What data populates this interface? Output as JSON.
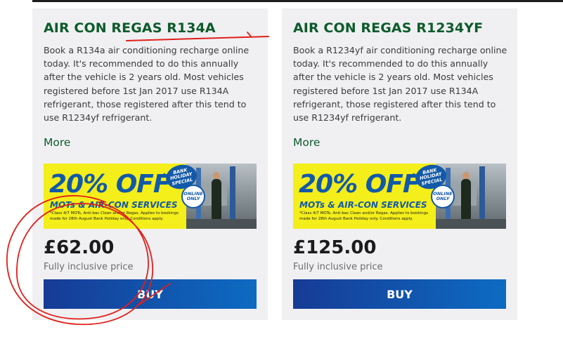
{
  "cards": [
    {
      "title": "AIR CON REGAS R134A",
      "description": "Book a R134a air conditioning recharge online today. It's recommended to do this annually after the vehicle is 2 years old. Most vehicles registered before 1st Jan 2017 use R134A refrigerant, those registered after this tend to use R1234yf refrigerant.",
      "more_label": "More",
      "promo": {
        "headline": "20% OFF",
        "asterisk": "*",
        "subline": "MOTs & AIR-CON SERVICES",
        "fine_print": "*Class 4/7 MOTs, Anti-bac Clean and/or Regas. Applies to bookings made for 28th August Bank Holiday only. Conditions apply.",
        "badge_bank": "BANK\nHOLIDAY\nSPECIAL",
        "badge_online": "ONLINE\nONLY"
      },
      "price": "£62.00",
      "price_note": "Fully inclusive price",
      "buy_label": "BUY"
    },
    {
      "title": "AIR CON REGAS R1234YF",
      "description": "Book a R1234yf air conditioning recharge online today. It's recommended to do this annually after the vehicle is 2 years old. Most vehicles registered before 1st Jan 2017 use R134A refrigerant, those registered after this tend to use R1234yf refrigerant.",
      "more_label": "More",
      "promo": {
        "headline": "20% OFF",
        "asterisk": "*",
        "subline": "MOTs & AIR-CON SERVICES",
        "fine_print": "*Class 4/7 MOTs, Anti-bac Clean and/or Regas. Applies to bookings made for 28th August Bank Holiday only. Conditions apply.",
        "badge_bank": "BANK\nHOLIDAY\nSPECIAL",
        "badge_online": "ONLINE\nONLY"
      },
      "price": "£125.00",
      "price_note": "Fully inclusive price",
      "buy_label": "BUY"
    }
  ],
  "colors": {
    "title_green": "#0d5b2a",
    "card_bg": "#f0f0f3",
    "promo_yellow": "#f4ee1a",
    "promo_blue": "#1259a8",
    "button_start": "#163b95",
    "button_end": "#0d6bc2",
    "annotation_red": "#e0201b"
  }
}
